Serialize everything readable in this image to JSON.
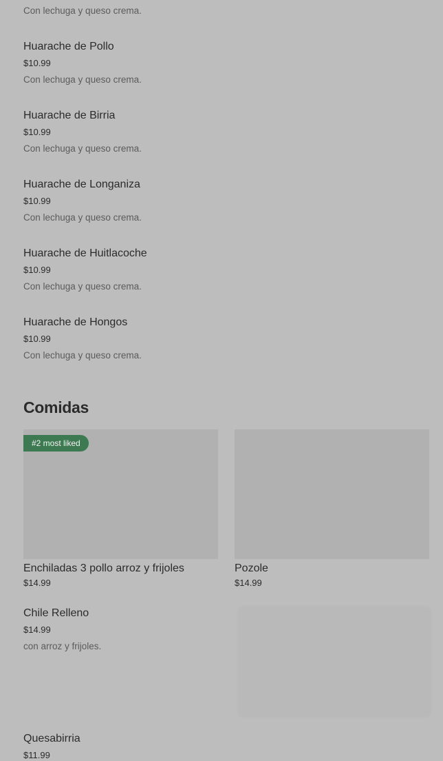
{
  "partial_top": {
    "desc": "Con lechuga y queso crema."
  },
  "huaraches": [
    {
      "name": "Huarache de Pollo",
      "price": "$10.99",
      "desc": "Con lechuga y queso crema."
    },
    {
      "name": "Huarache de Birria",
      "price": "$10.99",
      "desc": "Con lechuga y queso crema."
    },
    {
      "name": "Huarache de Longaniza",
      "price": "$10.99",
      "desc": "Con lechuga y queso crema."
    },
    {
      "name": "Huarache de Huitlacoche",
      "price": "$10.99",
      "desc": "Con lechuga y queso crema."
    },
    {
      "name": "Huarache de Hongos",
      "price": "$10.99",
      "desc": "Con lechuga y queso crema."
    }
  ],
  "comidas": {
    "title": "Comidas",
    "featured": [
      {
        "name": "Enchiladas 3 pollo arroz y frijoles",
        "price": "$14.99",
        "badge": "#2 most liked"
      },
      {
        "name": "Pozole",
        "price": "$14.99"
      }
    ],
    "items": [
      {
        "name": "Chile Relleno",
        "price": "$14.99",
        "desc": "con arroz y frijoles."
      },
      {
        "name": "Quesabirria",
        "price": "$11.99"
      }
    ]
  },
  "colors": {
    "background": "#bdbdbd",
    "badge": "#3d7a52",
    "image_placeholder": "#b1b1b1"
  }
}
